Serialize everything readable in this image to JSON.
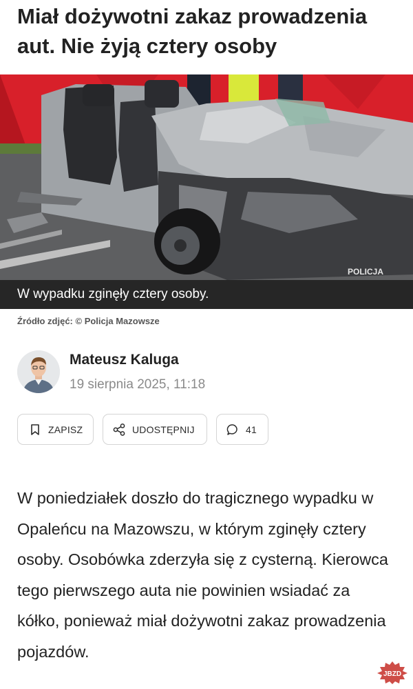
{
  "article": {
    "title": "Miał dożywotni zakaz prowadzenia aut. Nie żyją cztery osoby",
    "image": {
      "caption": "W wypadku zginęły cztery osoby.",
      "watermark": "POLICJA",
      "source": "Źródło zdjęć: © Policja Mazowsze"
    },
    "author": {
      "name": "Mateusz Kaluga",
      "date": "19 sierpnia 2025, 11:18"
    },
    "actions": {
      "save_label": "ZAPISZ",
      "share_label": "UDOSTĘPNIJ",
      "comments_count": "41"
    },
    "body": "W poniedziałek doszło do tragicznego wypadku w Opaleńcu na Mazowszu, w którym zginęły cztery osoby. Osobówka zderzyła się z cysterną. Kierowca tego pierwszego auta nie powinien wsiadać za kółko, ponieważ miał dożywotni zakaz prowadzenia pojazdów."
  },
  "site_watermark": "JBZD",
  "colors": {
    "caption_bg": "#262626",
    "screen_red": "#d8202a",
    "car_silver": "#b9bcbf",
    "watermark_bg": "#c62e27"
  },
  "icons": [
    "bookmark-icon",
    "share-icon",
    "comment-icon"
  ]
}
